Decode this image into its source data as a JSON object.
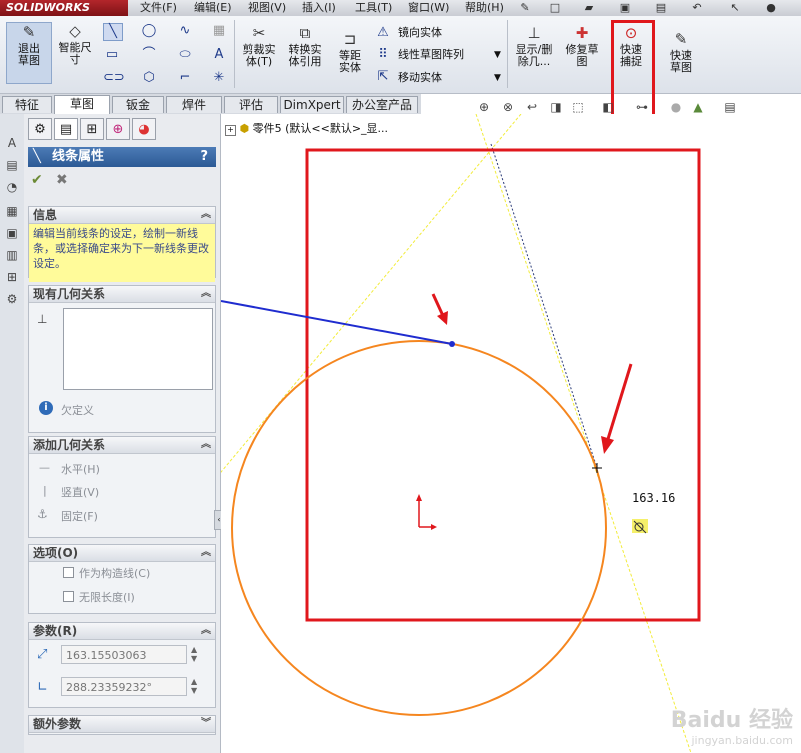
{
  "app": {
    "logo": "SOLIDWORKS"
  },
  "menu": [
    "文件(F)",
    "编辑(E)",
    "视图(V)",
    "插入(I)",
    "工具(T)",
    "窗口(W)",
    "帮助(H)"
  ],
  "ribbon": {
    "exit_sketch": "退出草图",
    "smart_dim": "智能尺寸",
    "trim": "剪裁实体(T)",
    "convert": "转换实体引用",
    "offset": "等距实体",
    "mirror": "镜向实体",
    "linear_pattern": "线性草图阵列",
    "move": "移动实体",
    "show_delete": "显示/删除几...",
    "repair": "修复草图",
    "quick_snaps": "快速捕捉",
    "rapid_sketch": "快速草图"
  },
  "tabs": [
    "特征",
    "草图",
    "钣金",
    "焊件",
    "评估",
    "DimXpert",
    "办公室产品"
  ],
  "active_tab": "草图",
  "pm": {
    "title": "线条属性",
    "info_head": "信息",
    "info_text": "编辑当前线条的设定，绘制一新线条，或选择确定来为下一新线条更改设定。",
    "existing_head": "现有几何关系",
    "under_defined": "欠定义",
    "add_head": "添加几何关系",
    "horizontal": "水平(H)",
    "vertical": "竖直(V)",
    "fix": "固定(F)",
    "options_head": "选项(O)",
    "construction": "作为构造线(C)",
    "infinite": "无限长度(I)",
    "params_head": "参数(R)",
    "length": "163.15503063",
    "angle": "288.23359232°",
    "extra_head": "额外参数"
  },
  "tree": {
    "part": "零件5 (默认<<默认>_显..."
  },
  "canvas": {
    "dim_readout": "163.16"
  },
  "colors": {
    "circle": "#f5861f",
    "line": "#1f2ccf",
    "highlight": "#e0171c",
    "guide": "#f2ec3a",
    "pm_header": "#3a69a6"
  },
  "watermark": {
    "brand": "Baidu 经验",
    "url": "jingyan.baidu.com"
  }
}
